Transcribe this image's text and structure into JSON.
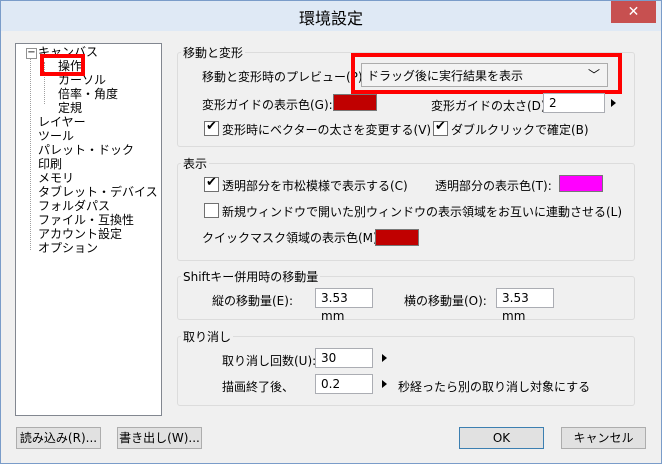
{
  "window": {
    "title": "環境設定",
    "close_glyph": "✕"
  },
  "tree": {
    "items": [
      {
        "label": "キャンバス"
      },
      {
        "label": "操作"
      },
      {
        "label": "カーソル"
      },
      {
        "label": "倍率・角度"
      },
      {
        "label": "定規"
      },
      {
        "label": "レイヤー"
      },
      {
        "label": "ツール"
      },
      {
        "label": "パレット・ドック"
      },
      {
        "label": "印刷"
      },
      {
        "label": "メモリ"
      },
      {
        "label": "タブレット・デバイス"
      },
      {
        "label": "フォルダパス"
      },
      {
        "label": "ファイル・互換性"
      },
      {
        "label": "アカウント設定"
      },
      {
        "label": "オプション"
      }
    ],
    "toggle_glyph": "−"
  },
  "move_transform": {
    "title": "移動と変形",
    "preview_label": "移動と変形時のプレビュー(P)",
    "preview_value": "ドラッグ後に実行結果を表示",
    "guide_color_label": "変形ガイドの表示色(G):",
    "guide_color": "#c00000",
    "guide_width_label": "変形ガイドの太さ(D):",
    "guide_width_value": "2",
    "vector_width_label": "変形時にベクターの太さを変更する(V)",
    "vector_width_checked": "✔",
    "double_click_label": "ダブルクリックで確定(B)",
    "double_click_checked": "✔"
  },
  "display": {
    "title": "表示",
    "checker_label": "透明部分を市松模様で表示する(C)",
    "checker_checked": "✔",
    "transparent_color_label": "透明部分の表示色(T):",
    "transparent_color": "#ff00ff",
    "sync_label": "新規ウィンドウで開いた別ウィンドウの表示領域をお互いに連動させる(L)",
    "quickmask_label": "クイックマスク領域の表示色(M):",
    "quickmask_color": "#c00000"
  },
  "shift_move": {
    "title": "Shiftキー併用時の移動量",
    "vertical_label": "縦の移動量(E):",
    "vertical_value": "3.53 mm",
    "horizontal_label": "横の移動量(O):",
    "horizontal_value": "3.53 mm"
  },
  "undo": {
    "title": "取り消し",
    "count_label": "取り消し回数(U):",
    "count_value": "30",
    "after_draw_label": "描画終了後、",
    "after_draw_value": "0.2",
    "after_draw_suffix": "秒経ったら別の取り消し対象にする"
  },
  "buttons": {
    "load": "読み込み(R)...",
    "save": "書き出し(W)...",
    "ok": "OK",
    "cancel": "キャンセル"
  },
  "colors": {
    "highlight": "#ff0000"
  }
}
